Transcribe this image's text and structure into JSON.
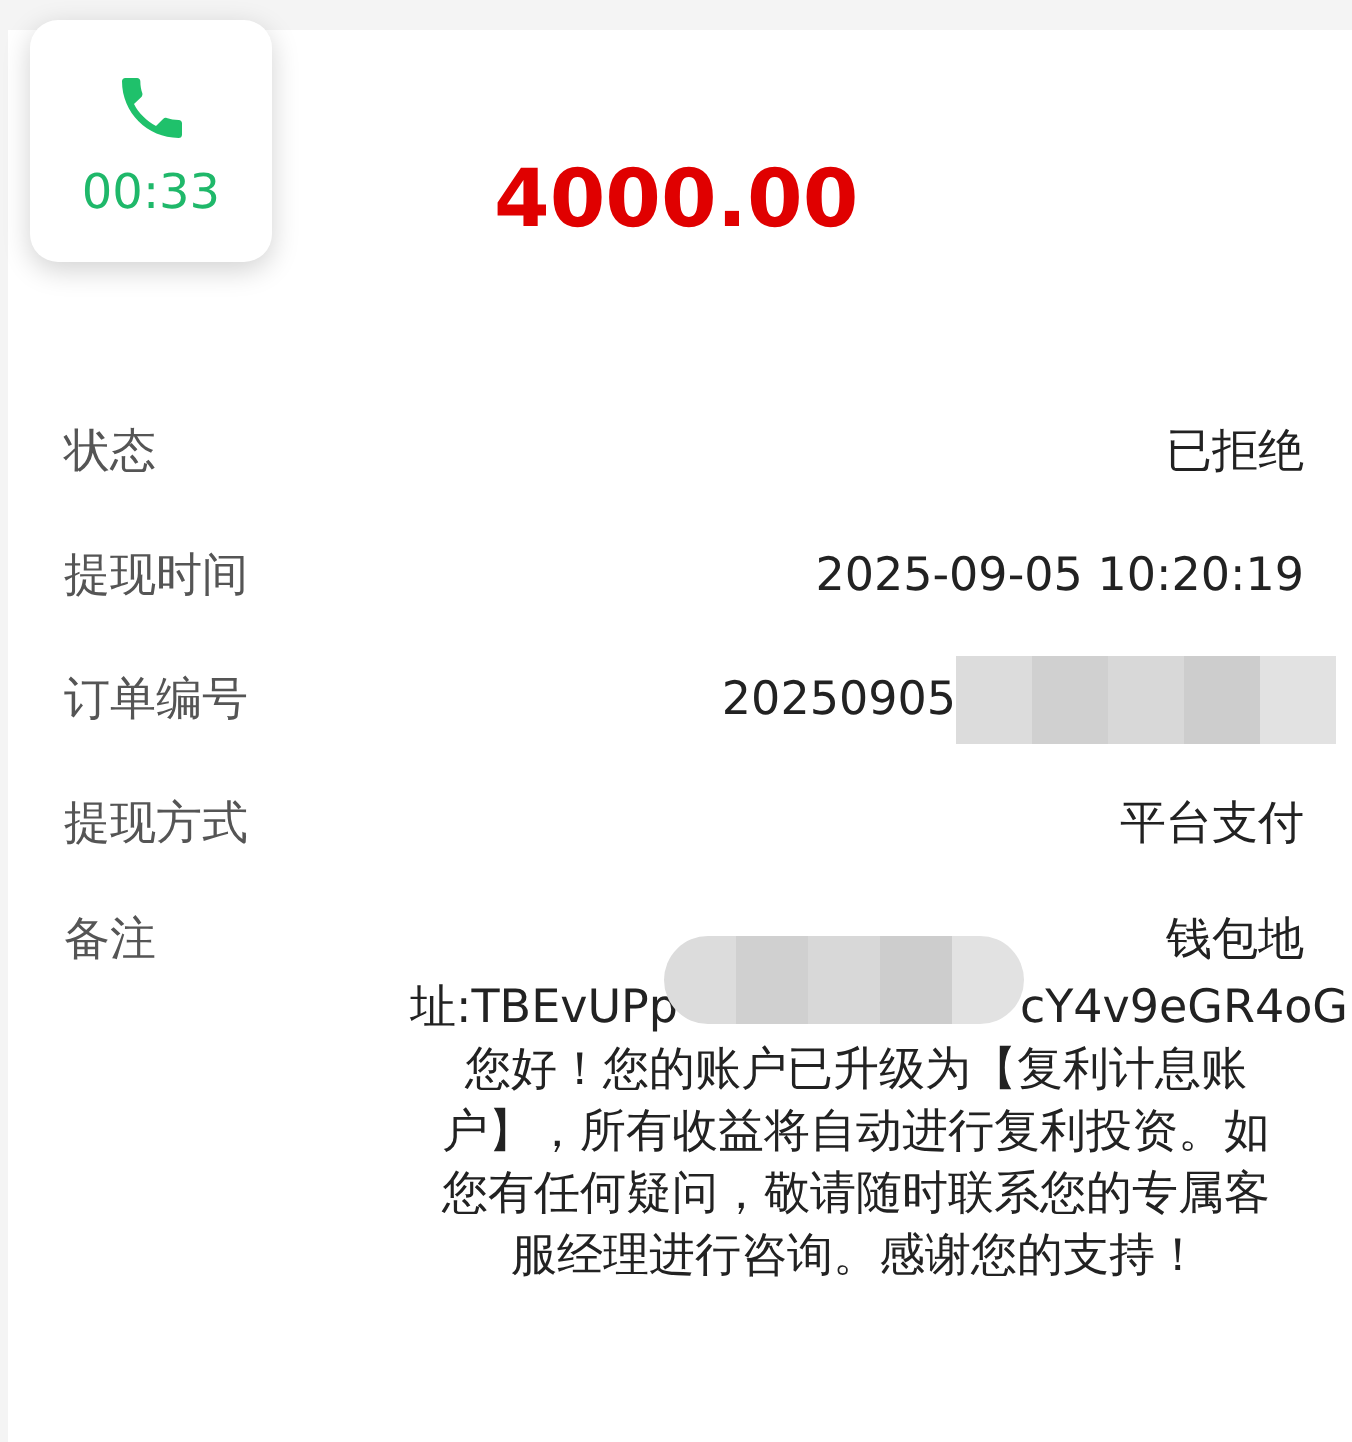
{
  "call_widget": {
    "duration": "00:33"
  },
  "amount": "4000.00",
  "rows": [
    {
      "label": "状态",
      "value": "已拒绝"
    },
    {
      "label": "提现时间",
      "value": "2025-09-05 10:20:19"
    },
    {
      "label": "订单编号",
      "value": "20250905",
      "redacted": true
    },
    {
      "label": "提现方式",
      "value": "平台支付"
    }
  ],
  "remark": {
    "label": "备注",
    "first_line": "钱包地",
    "address_start": "址:TBEvUPp",
    "address_end": "cY4v9eGR4oG",
    "message_lines": [
      "您好！您的账户已升级为【复利计息账",
      "户】，所有收益将自动进行复利投资。如",
      "您有任何疑问，敬请随时联系您的专属客",
      "服经理进行咨询。感谢您的支持！"
    ]
  }
}
